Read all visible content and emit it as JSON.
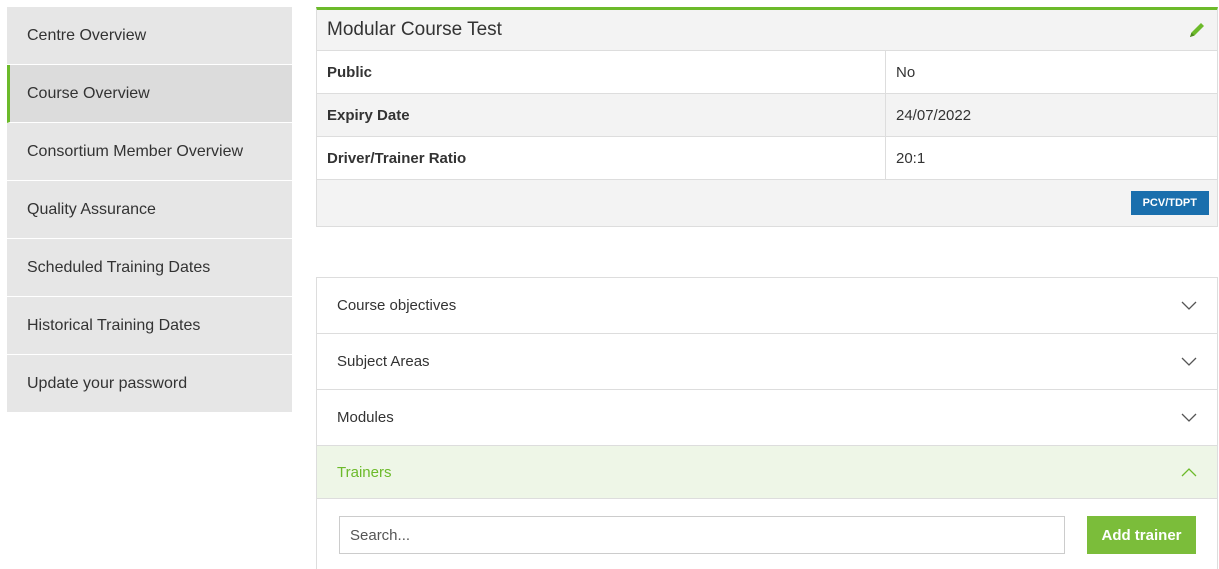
{
  "sidebar": {
    "items": [
      {
        "label": "Centre Overview"
      },
      {
        "label": "Course Overview"
      },
      {
        "label": "Consortium Member Overview"
      },
      {
        "label": "Quality Assurance"
      },
      {
        "label": "Scheduled Training Dates"
      },
      {
        "label": "Historical Training Dates"
      },
      {
        "label": "Update your password"
      }
    ],
    "active_item": "Course Overview"
  },
  "course": {
    "title": "Modular Course Test",
    "edit_icon": "pencil-icon",
    "rows": [
      {
        "label": "Public",
        "value": "No"
      },
      {
        "label": "Expiry Date",
        "value": "24/07/2022"
      },
      {
        "label": "Driver/Trainer Ratio",
        "value": "20:1"
      }
    ],
    "badge_label": "PCV/TDPT"
  },
  "accordion": {
    "sections": [
      {
        "label": "Course objectives",
        "state": "collapsed"
      },
      {
        "label": "Subject Areas",
        "state": "collapsed"
      },
      {
        "label": "Modules",
        "state": "collapsed"
      },
      {
        "label": "Trainers",
        "state": "expanded"
      }
    ],
    "trainers": {
      "search_placeholder": "Search...",
      "add_button_label": "Add trainer"
    }
  },
  "colors": {
    "accent_green": "#6cba2a",
    "button_green": "#7bbd3a",
    "button_blue": "#1a6fad",
    "sidebar_bg": "#e6e6e6"
  }
}
